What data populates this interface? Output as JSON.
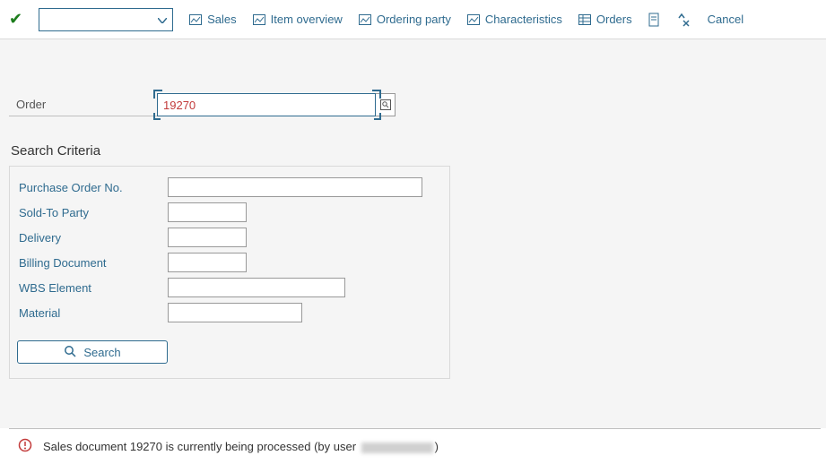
{
  "toolbar": {
    "combo_value": "",
    "items": [
      {
        "label": "Sales"
      },
      {
        "label": "Item overview"
      },
      {
        "label": "Ordering party"
      },
      {
        "label": "Characteristics"
      },
      {
        "label": "Orders"
      }
    ],
    "cancel": "Cancel"
  },
  "order": {
    "label": "Order",
    "value": "19270"
  },
  "criteria": {
    "header": "Search Criteria",
    "rows": [
      {
        "label": "Purchase Order No.",
        "width": "w-long",
        "value": ""
      },
      {
        "label": "Sold-To Party",
        "width": "w-short",
        "value": ""
      },
      {
        "label": "Delivery",
        "width": "w-short",
        "value": ""
      },
      {
        "label": "Billing Document",
        "width": "w-short",
        "value": ""
      },
      {
        "label": "WBS Element",
        "width": "w-mid",
        "value": ""
      },
      {
        "label": "Material",
        "width": "w-mat",
        "value": ""
      }
    ],
    "search_btn": "Search"
  },
  "status": {
    "text_before": "Sales document 19270 is currently being processed (by user",
    "text_after": ")"
  }
}
